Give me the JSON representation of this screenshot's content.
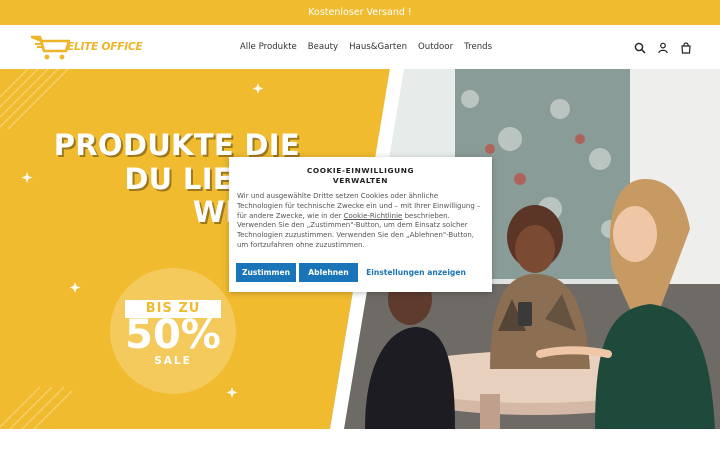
{
  "announcement": "Kostenloser Versand !",
  "brand": {
    "name": "ELITE OFFICE"
  },
  "nav": {
    "items": [
      "Alle Produkte",
      "Beauty",
      "Haus&Garten",
      "Outdoor",
      "Trends"
    ]
  },
  "header_icons": [
    "search-icon",
    "account-icon",
    "cart-icon"
  ],
  "hero": {
    "title_lines": [
      "PRODUKTE DIE",
      "DU LIEBEN",
      "WIRST"
    ],
    "sale_badge": "BIS ZU",
    "sale_percent": "50%",
    "sale_word": "SALE"
  },
  "cookie": {
    "title": "COOKIE-EINWILLIGUNG VERWALTEN",
    "text_before_link": "Wir und ausgewählte Dritte setzen Cookies oder ähnliche Technologien für technische Zwecke ein und – mit Ihrer Einwilligung – für andere Zwecke, wie in der ",
    "link": "Cookie-Richtlinie",
    "text_after_link": " beschrieben. Verwenden Sie den „Zustimmen\"-Button, um dem Einsatz solcher Technologien zuzustimmen. Verwenden Sie den „Ablehnen\"-Button, um fortzufahren ohne zuzustimmen.",
    "accept": "Zustimmen",
    "decline": "Ablehnen",
    "settings": "Einstellungen anzeigen"
  },
  "colors": {
    "brand_yellow": "#f1bb2f",
    "button_blue": "#1a75b8"
  }
}
